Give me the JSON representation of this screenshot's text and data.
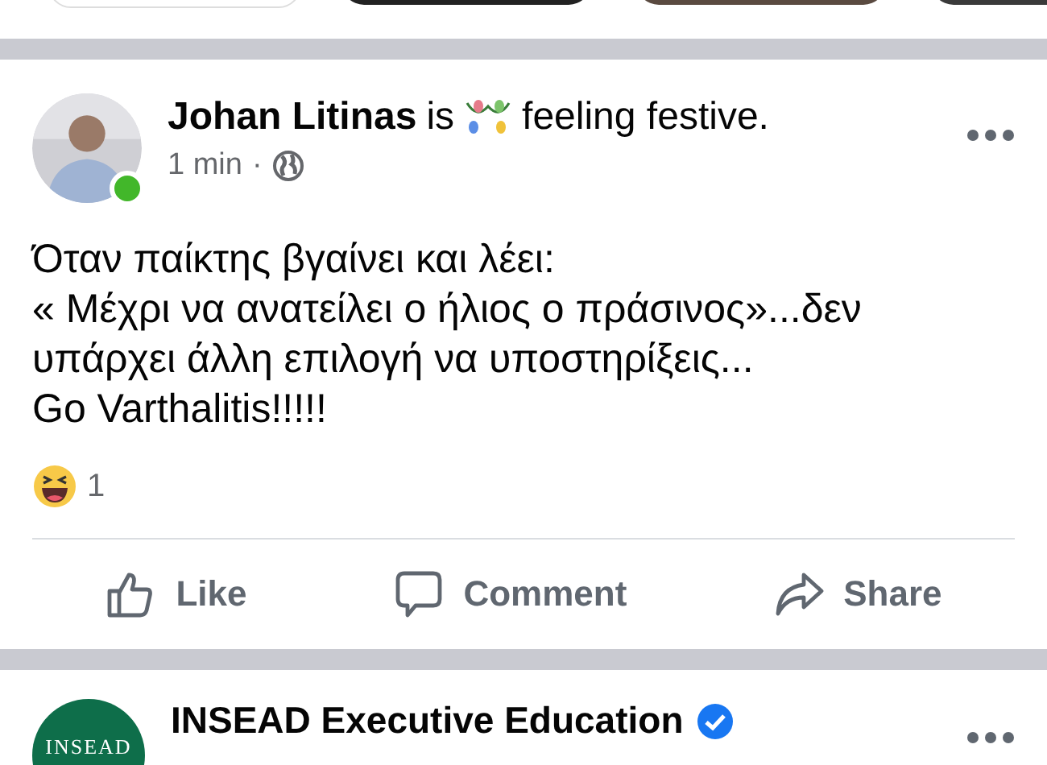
{
  "post": {
    "author": "Johan Litinas",
    "verb": "is",
    "feeling": "feeling festive.",
    "online": true,
    "time": "1 min",
    "separator": "·",
    "text": [
      "Όταν παίκτης βγαίνει και λέει:",
      "« Μέχρι να ανατείλει ο ήλιος ο πράσινος»...δεν υπάρχει άλλη επιλογή να υποστηρίξεις...",
      "Go Varthalitis!!!!!"
    ],
    "reactions": {
      "count": "1"
    },
    "actions": [
      {
        "kind": "like",
        "label": "Like"
      },
      {
        "kind": "comment",
        "label": "Comment"
      },
      {
        "kind": "share",
        "label": "Share"
      }
    ]
  },
  "next_post": {
    "author": "INSEAD Executive Education",
    "verified": true,
    "logo_text": "INSEAD"
  }
}
